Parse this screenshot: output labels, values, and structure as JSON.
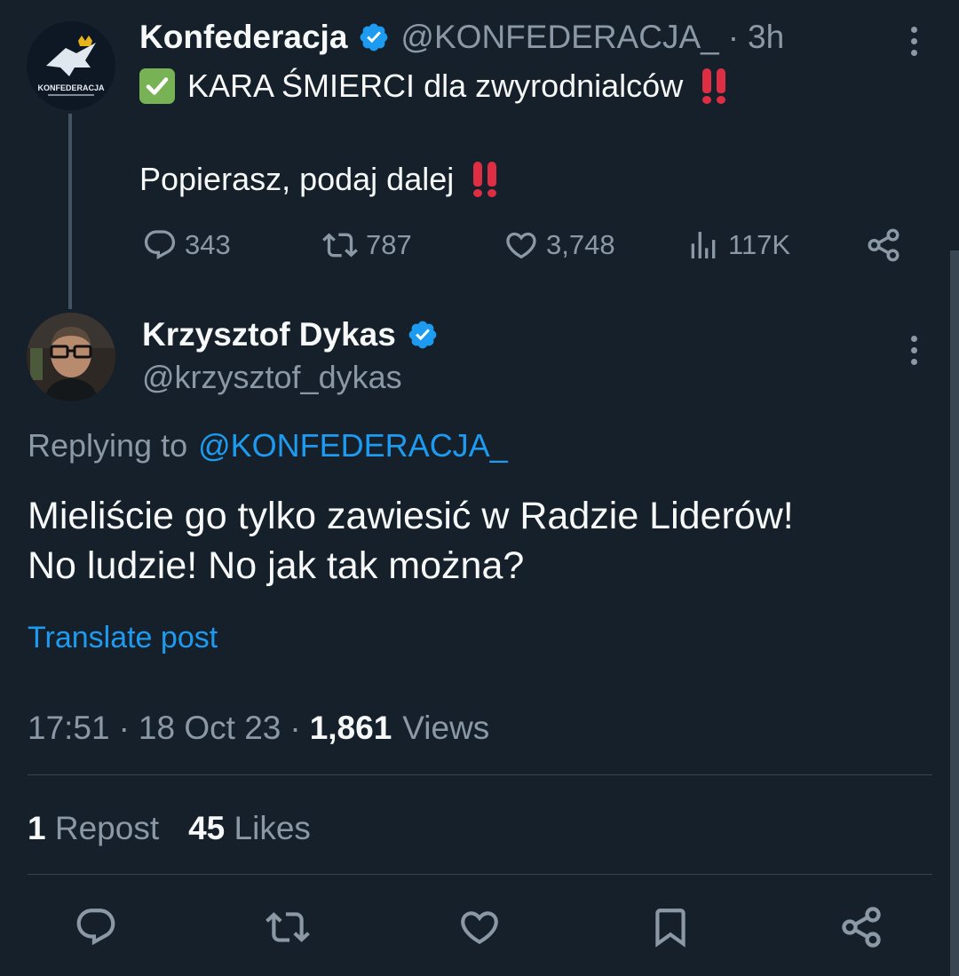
{
  "parent_tweet": {
    "author_name": "Konfederacja",
    "handle": "@KONFEDERACJA_",
    "separator": "·",
    "time": "3h",
    "line1_text": "KARA ŚMIERCI dla zwyrodnialców",
    "line2_text": "Popierasz, podaj dalej",
    "avatar_logo_text": "KONFEDERACJA",
    "actions": {
      "replies": "343",
      "reposts": "787",
      "likes": "3,748",
      "views": "117K"
    }
  },
  "main_tweet": {
    "author_name": "Krzysztof Dykas",
    "handle": "@krzysztof_dykas",
    "replying_to_label": "Replying to",
    "replying_to_handle": "@KONFEDERACJA_",
    "body_line1": "Mieliście go tylko zawiesić w Radzie Liderów!",
    "body_line2": "No ludzie! No jak tak można?",
    "translate_label": "Translate post",
    "time": "17:51",
    "date": "18 Oct 23",
    "views_count": "1,861",
    "views_label": "Views",
    "repost_count": "1",
    "repost_label": "Repost",
    "likes_count": "45",
    "likes_label": "Likes"
  },
  "colors": {
    "background": "#15202b",
    "text": "#f7f9f9",
    "muted": "#8b98a5",
    "accent": "#1d9bf0",
    "verified": "#1d9bf0",
    "emoji_red": "#dd2e44",
    "checkbox_green": "#77b255"
  },
  "icons": {
    "parent_actions": [
      "reply-icon",
      "repost-icon",
      "like-icon",
      "views-icon",
      "share-icon"
    ],
    "bottom_bar": [
      "reply-icon",
      "repost-icon",
      "like-icon",
      "bookmark-icon",
      "share-icon"
    ]
  }
}
